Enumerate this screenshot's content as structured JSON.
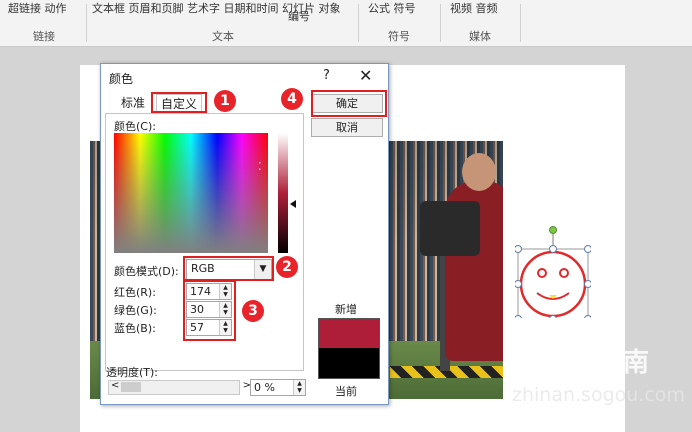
{
  "ribbon": {
    "top_texts": [
      "超链接 动作",
      "文本框 页眉和页脚 艺术字 日期和时间 幻灯片 对象",
      "编号",
      "公式 符号",
      "视频 音频"
    ],
    "groups": [
      "链接",
      "文本",
      "符号",
      "媒体"
    ]
  },
  "dialog": {
    "title": "颜色",
    "help": "?",
    "close": "✕",
    "tabs": [
      "标准",
      "自定义"
    ],
    "colors_label": "颜色(C):",
    "mode_label": "颜色模式(D):",
    "mode_value": "RGB",
    "red_label": "红色(R):",
    "red_value": "174",
    "green_label": "绿色(G):",
    "green_value": "30",
    "blue_label": "蓝色(B):",
    "blue_value": "57",
    "ok": "确定",
    "cancel": "取消",
    "new_label": "新增",
    "current_label": "当前",
    "transparency_label": "透明度(T):",
    "transparency_value": "0 %",
    "new_color": "#ae1e39",
    "current_color": "#000000"
  },
  "badges": [
    "1",
    "2",
    "3",
    "4"
  ],
  "watermark": {
    "brand": "搜狗指南",
    "url": "zhinan.sogou.com"
  }
}
